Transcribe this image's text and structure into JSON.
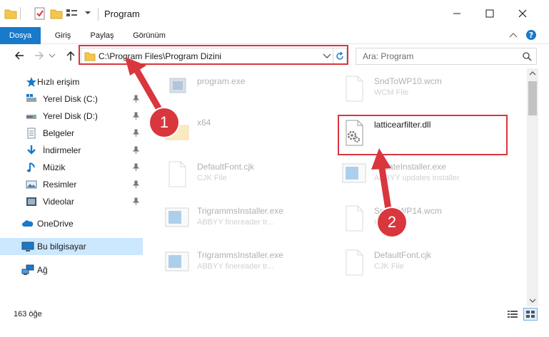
{
  "window": {
    "title": "Program",
    "minimize_label": "—",
    "maximize_label": "☐",
    "close_label": "✕"
  },
  "ribbon": {
    "tabs": [
      {
        "label": "Dosya",
        "active": true
      },
      {
        "label": "Giriş",
        "active": false
      },
      {
        "label": "Paylaş",
        "active": false
      },
      {
        "label": "Görünüm",
        "active": false
      }
    ]
  },
  "address": {
    "path": "C:\\Program Files\\Program Dizini",
    "search_placeholder": "Ara: Program"
  },
  "nav_pane": {
    "items": [
      {
        "label": "Hızlı erişim",
        "icon": "star-icon"
      },
      {
        "label": "Yerel Disk (C:)",
        "icon": "drive-icon"
      },
      {
        "label": "Yerel Disk (D:)",
        "icon": "drive-icon"
      },
      {
        "label": "Belgeler",
        "icon": "document-icon"
      },
      {
        "label": "İndirmeler",
        "icon": "download-icon"
      },
      {
        "label": "Müzik",
        "icon": "music-icon"
      },
      {
        "label": "Resimler",
        "icon": "pictures-icon"
      },
      {
        "label": "Videolar",
        "icon": "video-icon"
      },
      {
        "label": "OneDrive",
        "icon": "cloud-icon"
      },
      {
        "label": "Bu bilgisayar",
        "icon": "computer-icon"
      },
      {
        "label": "Ağ",
        "icon": "network-icon"
      }
    ]
  },
  "files": [
    {
      "name": "program.exe",
      "type": ""
    },
    {
      "name": "SndToWP10.wcm",
      "type": "WCM File"
    },
    {
      "name": "x64",
      "type": ""
    },
    {
      "name": "latticearfilter.dll",
      "type": ""
    },
    {
      "name": "DefaultFont.cjk",
      "type": "CJK File"
    },
    {
      "name": "updateInstaller.exe",
      "type": "ABBYY updates installer"
    },
    {
      "name": "TrigrammsInstaller.exe",
      "type": "ABBYY finereader tr..."
    },
    {
      "name": "SndToWP14.wcm",
      "type": "WCM File"
    },
    {
      "name": "TrigrammsInstaller.exe",
      "type": "ABBYY finereader tr..."
    },
    {
      "name": "DefaultFont.cjk",
      "type": "CJK File"
    }
  ],
  "status": {
    "item_count": "163 öğe"
  },
  "annotations": {
    "badge1": "1",
    "badge2": "2"
  },
  "colors": {
    "accent": "#1979ca",
    "annotation_red": "#d9363e",
    "selected_bg": "#cce8ff"
  }
}
